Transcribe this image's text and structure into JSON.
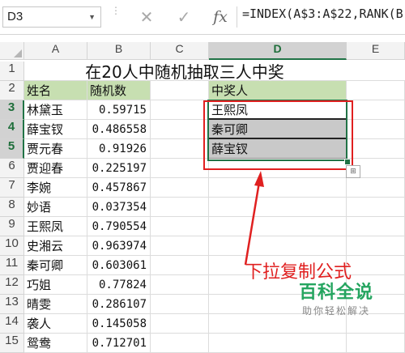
{
  "formula_bar": {
    "name_box": "D3",
    "cancel_icon": "✕",
    "enter_icon": "✓",
    "fx_label": "fx",
    "formula": "=INDEX(A$3:A$22,RANK(B"
  },
  "columns": [
    "A",
    "B",
    "C",
    "D",
    "E"
  ],
  "rows": [
    "1",
    "2",
    "3",
    "4",
    "5",
    "6",
    "7",
    "8",
    "9",
    "10",
    "11",
    "12",
    "13",
    "14",
    "15"
  ],
  "sheet": {
    "title": "在20人中随机抽取三人中奖",
    "header_name": "姓名",
    "header_random": "随机数",
    "header_winner": "中奖人",
    "people": [
      {
        "name": "林黛玉",
        "rand": "0.59715"
      },
      {
        "name": "薛宝钗",
        "rand": "0.486558"
      },
      {
        "name": "贾元春",
        "rand": "0.91926"
      },
      {
        "name": "贾迎春",
        "rand": "0.225197"
      },
      {
        "name": "李婉",
        "rand": "0.457867"
      },
      {
        "name": "妙语",
        "rand": "0.037354"
      },
      {
        "name": "王熙凤",
        "rand": "0.790554"
      },
      {
        "name": "史湘云",
        "rand": "0.963974"
      },
      {
        "name": "秦可卿",
        "rand": "0.603061"
      },
      {
        "name": "巧姐",
        "rand": "0.77824"
      },
      {
        "name": "晴雯",
        "rand": "0.286107"
      },
      {
        "name": "袭人",
        "rand": "0.145058"
      },
      {
        "name": "鸳鸯",
        "rand": "0.712701"
      }
    ],
    "winners": [
      "王熙凤",
      "秦可卿",
      "薛宝钗"
    ]
  },
  "annotation": "下拉复制公式",
  "watermark": {
    "big": "百科全说",
    "small": "助你轻松解决"
  },
  "colors": {
    "selection": "#217346",
    "annotation": "#e02020",
    "header_fill": "#c7dfb1"
  }
}
